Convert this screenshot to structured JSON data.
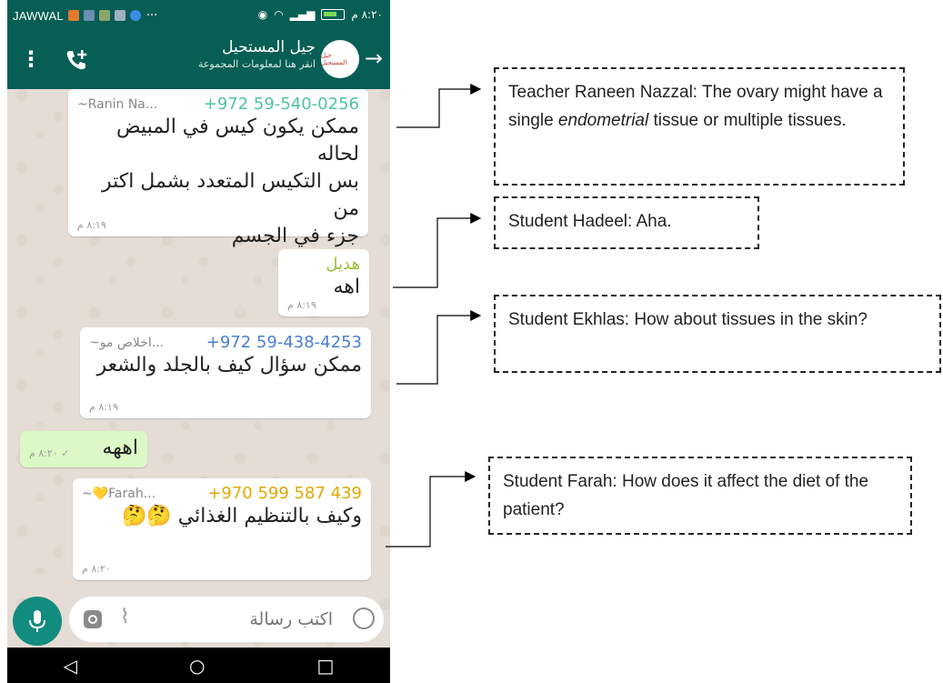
{
  "status_bar": {
    "carrier": "JAWWAL",
    "overflow": "···",
    "right_text": "٨:٢٠ م"
  },
  "header": {
    "group_name": "جيل المستحيل",
    "group_subtitle": "انقر هنا لمعلومات المجموعة",
    "avatar_text": "جيل المستحيل",
    "back_icon": "arrow-right-icon",
    "menu_icon": "overflow-menu-icon",
    "call_icon": "add-call-icon"
  },
  "messages": [
    {
      "phone": "+972 59-540-0256",
      "name": "~Ranin Na...",
      "sender_color": "#4fc3a1",
      "lines": [
        "ممكن يكون كيس في المبيض",
        "لحاله",
        "بس التكيس المتعدد بشمل اكتر من",
        "جزء في الجسم"
      ],
      "time": "٨:١٩ م"
    },
    {
      "phone": "",
      "name": "هديل",
      "sender_color": "#9cbf3a",
      "lines": [
        "اهه"
      ],
      "time": "٨:١٩ م"
    },
    {
      "phone": "+972 59-438-4253",
      "name": "~اخلاص مو...",
      "sender_color": "#4a7fd4",
      "lines": [
        "ممكن سؤال كيف بالجلد والشعر"
      ],
      "time": "٨:١٩ م"
    },
    {
      "phone": "",
      "name": "",
      "sender_color": "",
      "lines": [
        "اههه"
      ],
      "time": "٨:٢٠ م ✓"
    },
    {
      "phone": "+970 599 587 439",
      "name": "~💛Farah...",
      "sender_color": "#e0a800",
      "lines": [
        "وكيف بالتنظيم الغذائي 🤔🤔"
      ],
      "time": "٨:٢٠ م"
    }
  ],
  "input": {
    "placeholder": "اكتب رسالة",
    "mic_icon": "microphone-icon",
    "camera_icon": "camera-icon",
    "attach_icon": "paperclip-icon",
    "emoji_icon": "emoji-icon"
  },
  "nav": {
    "back": "◁",
    "home": "○",
    "recents": "□"
  },
  "annotations": [
    {
      "pre": "Teacher Raneen Nazzal: The ovary might have a single ",
      "em": "endometrial",
      "post": " tissue or multiple tissues."
    },
    {
      "pre": "Student Hadeel: Aha.",
      "em": "",
      "post": ""
    },
    {
      "pre": "Student Ekhlas: How about tissues in the skin?",
      "em": "",
      "post": ""
    },
    {
      "pre": "Student Farah: How does it affect the diet of the patient?",
      "em": "",
      "post": ""
    }
  ],
  "colors": {
    "header_green": "#075e54",
    "outgoing_bubble": "#dcf8c6",
    "mic_green": "#128c7e"
  }
}
